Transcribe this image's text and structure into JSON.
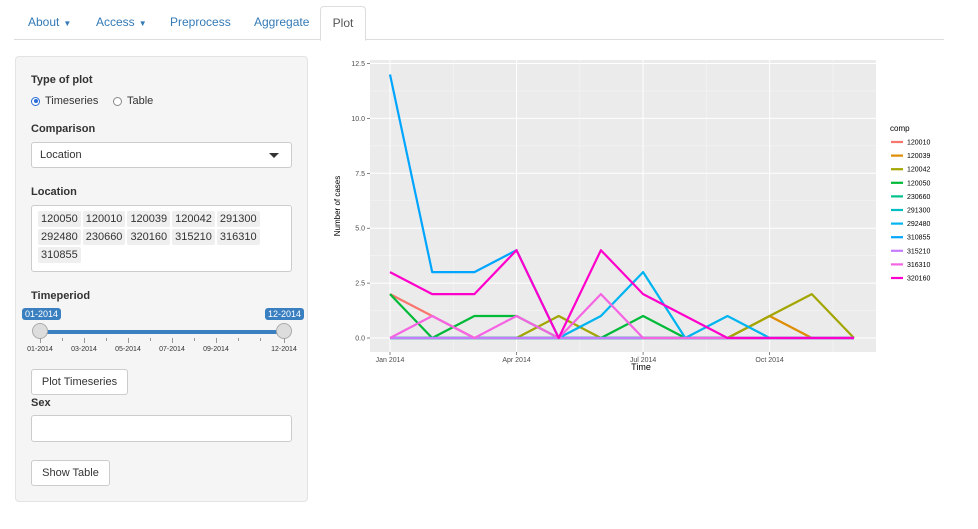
{
  "tabs": [
    {
      "label": "About",
      "dropdown": true
    },
    {
      "label": "Access",
      "dropdown": true
    },
    {
      "label": "Preprocess",
      "dropdown": false
    },
    {
      "label": "Aggregate",
      "dropdown": false
    },
    {
      "label": "Plot",
      "dropdown": false,
      "active": true
    }
  ],
  "sidebar": {
    "type_label": "Type of plot",
    "type_options": [
      {
        "label": "Timeseries",
        "selected": true
      },
      {
        "label": "Table",
        "selected": false
      }
    ],
    "comparison_label": "Comparison",
    "comparison_value": "Location",
    "location_label": "Location",
    "location_tags": [
      "120050",
      "120010",
      "120039",
      "120042",
      "291300",
      "292480",
      "230660",
      "320160",
      "315210",
      "316310",
      "310855"
    ],
    "timeperiod_label": "Timeperiod",
    "timeperiod_from": "01-2014",
    "timeperiod_to": "12-2014",
    "timeperiod_ticks": [
      "01-2014",
      "03-2014",
      "05-2014",
      "07-2014",
      "09-2014",
      "12-2014"
    ],
    "plot_button": "Plot Timeseries",
    "sex_label": "Sex",
    "sex_value": "",
    "show_table_button": "Show Table"
  },
  "colors": {
    "accent": "#337ab7",
    "slider": "#3a7fc0",
    "plot_bg": "#ebebeb"
  },
  "chart_data": {
    "type": "line",
    "xlabel": "Time",
    "ylabel": "Number of cases",
    "legend_title": "comp",
    "legend_position": "right",
    "grid": true,
    "ylim": [
      0,
      12.5
    ],
    "yticks": [
      0,
      2.5,
      5,
      7.5,
      10,
      12.5
    ],
    "ytick_labels": [
      "0.0",
      "2.5",
      "5.0",
      "7.5",
      "10.0",
      "12.5"
    ],
    "x": [
      "2014-01",
      "2014-02",
      "2014-03",
      "2014-04",
      "2014-05",
      "2014-06",
      "2014-07",
      "2014-08",
      "2014-09",
      "2014-10",
      "2014-11",
      "2014-12"
    ],
    "xticks": [
      "2014-01",
      "2014-04",
      "2014-07",
      "2014-10"
    ],
    "xtick_labels": [
      "Jan 2014",
      "Apr 2014",
      "Jul 2014",
      "Oct 2014"
    ],
    "series": [
      {
        "name": "120010",
        "color": "#F8766D",
        "values": [
          2,
          1,
          0,
          0,
          0,
          0,
          0,
          0,
          0,
          0,
          0,
          0
        ]
      },
      {
        "name": "120039",
        "color": "#DE8C00",
        "values": [
          0,
          0,
          0,
          0,
          0,
          0,
          0,
          0,
          0,
          1,
          0,
          0
        ]
      },
      {
        "name": "120042",
        "color": "#A3A500",
        "values": [
          0,
          0,
          0,
          0,
          1,
          0,
          0,
          0,
          0,
          1,
          2,
          0
        ]
      },
      {
        "name": "120050",
        "color": "#00BA38",
        "values": [
          2,
          0,
          1,
          1,
          0,
          0,
          1,
          0,
          0,
          0,
          0,
          0
        ]
      },
      {
        "name": "230660",
        "color": "#00C08B",
        "values": [
          0,
          0,
          0,
          0,
          0,
          0,
          0,
          0,
          0,
          0,
          0,
          0
        ]
      },
      {
        "name": "291300",
        "color": "#00BFC4",
        "values": [
          0,
          0,
          0,
          0,
          0,
          0,
          0,
          0,
          0,
          0,
          0,
          0
        ]
      },
      {
        "name": "292480",
        "color": "#00B4F0",
        "values": [
          0,
          0,
          0,
          0,
          0,
          1,
          3,
          0,
          1,
          0,
          0,
          0
        ]
      },
      {
        "name": "310855",
        "color": "#00A5FF",
        "values": [
          12,
          3,
          3,
          4,
          0,
          0,
          0,
          0,
          0,
          0,
          0,
          0
        ]
      },
      {
        "name": "315210",
        "color": "#C77CFF",
        "values": [
          0,
          0,
          0,
          0,
          0,
          0,
          0,
          0,
          0,
          0,
          0,
          0
        ]
      },
      {
        "name": "316310",
        "color": "#F564E3",
        "values": [
          0,
          1,
          0,
          1,
          0,
          2,
          0,
          0,
          0,
          0,
          0,
          0
        ]
      },
      {
        "name": "320160",
        "color": "#FF00CC",
        "values": [
          3,
          2,
          2,
          4,
          0,
          4,
          2,
          1,
          0,
          0,
          0,
          0
        ]
      }
    ]
  }
}
